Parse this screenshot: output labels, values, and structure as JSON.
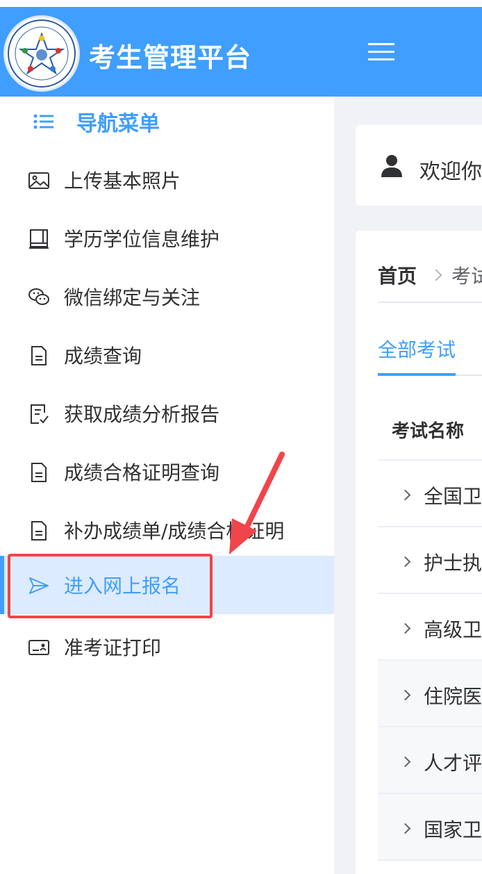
{
  "app": {
    "title": "考生管理平台"
  },
  "sidebar": {
    "nav_title": "导航菜单",
    "items": [
      {
        "label": "上传基本照片",
        "icon": "image-icon",
        "active": false
      },
      {
        "label": "学历学位信息维护",
        "icon": "book-icon",
        "active": false
      },
      {
        "label": "微信绑定与关注",
        "icon": "wechat-icon",
        "active": false
      },
      {
        "label": "成绩查询",
        "icon": "document-icon",
        "active": false
      },
      {
        "label": "获取成绩分析报告",
        "icon": "report-check-icon",
        "active": false
      },
      {
        "label": "成绩合格证明查询",
        "icon": "document-icon",
        "active": false
      },
      {
        "label": "补办成绩单/成绩合格证明",
        "icon": "document-icon",
        "active": false
      },
      {
        "label": "进入网上报名",
        "icon": "send-icon",
        "active": true
      },
      {
        "label": "准考证打印",
        "icon": "id-card-icon",
        "active": false
      }
    ]
  },
  "main": {
    "welcome": "欢迎你",
    "breadcrumb": {
      "home": "首页",
      "current": "考试"
    },
    "tabs": [
      {
        "label": "全部考试",
        "active": true
      }
    ],
    "table": {
      "column_header": "考试名称",
      "rows": [
        "全国卫",
        "护士执",
        "高级卫",
        "住院医",
        "人才评",
        "国家卫"
      ]
    }
  },
  "colors": {
    "primary": "#409eff",
    "active_bg": "#dcebfd",
    "highlight": "#f0454a",
    "page_bg": "#f0f2f5"
  }
}
